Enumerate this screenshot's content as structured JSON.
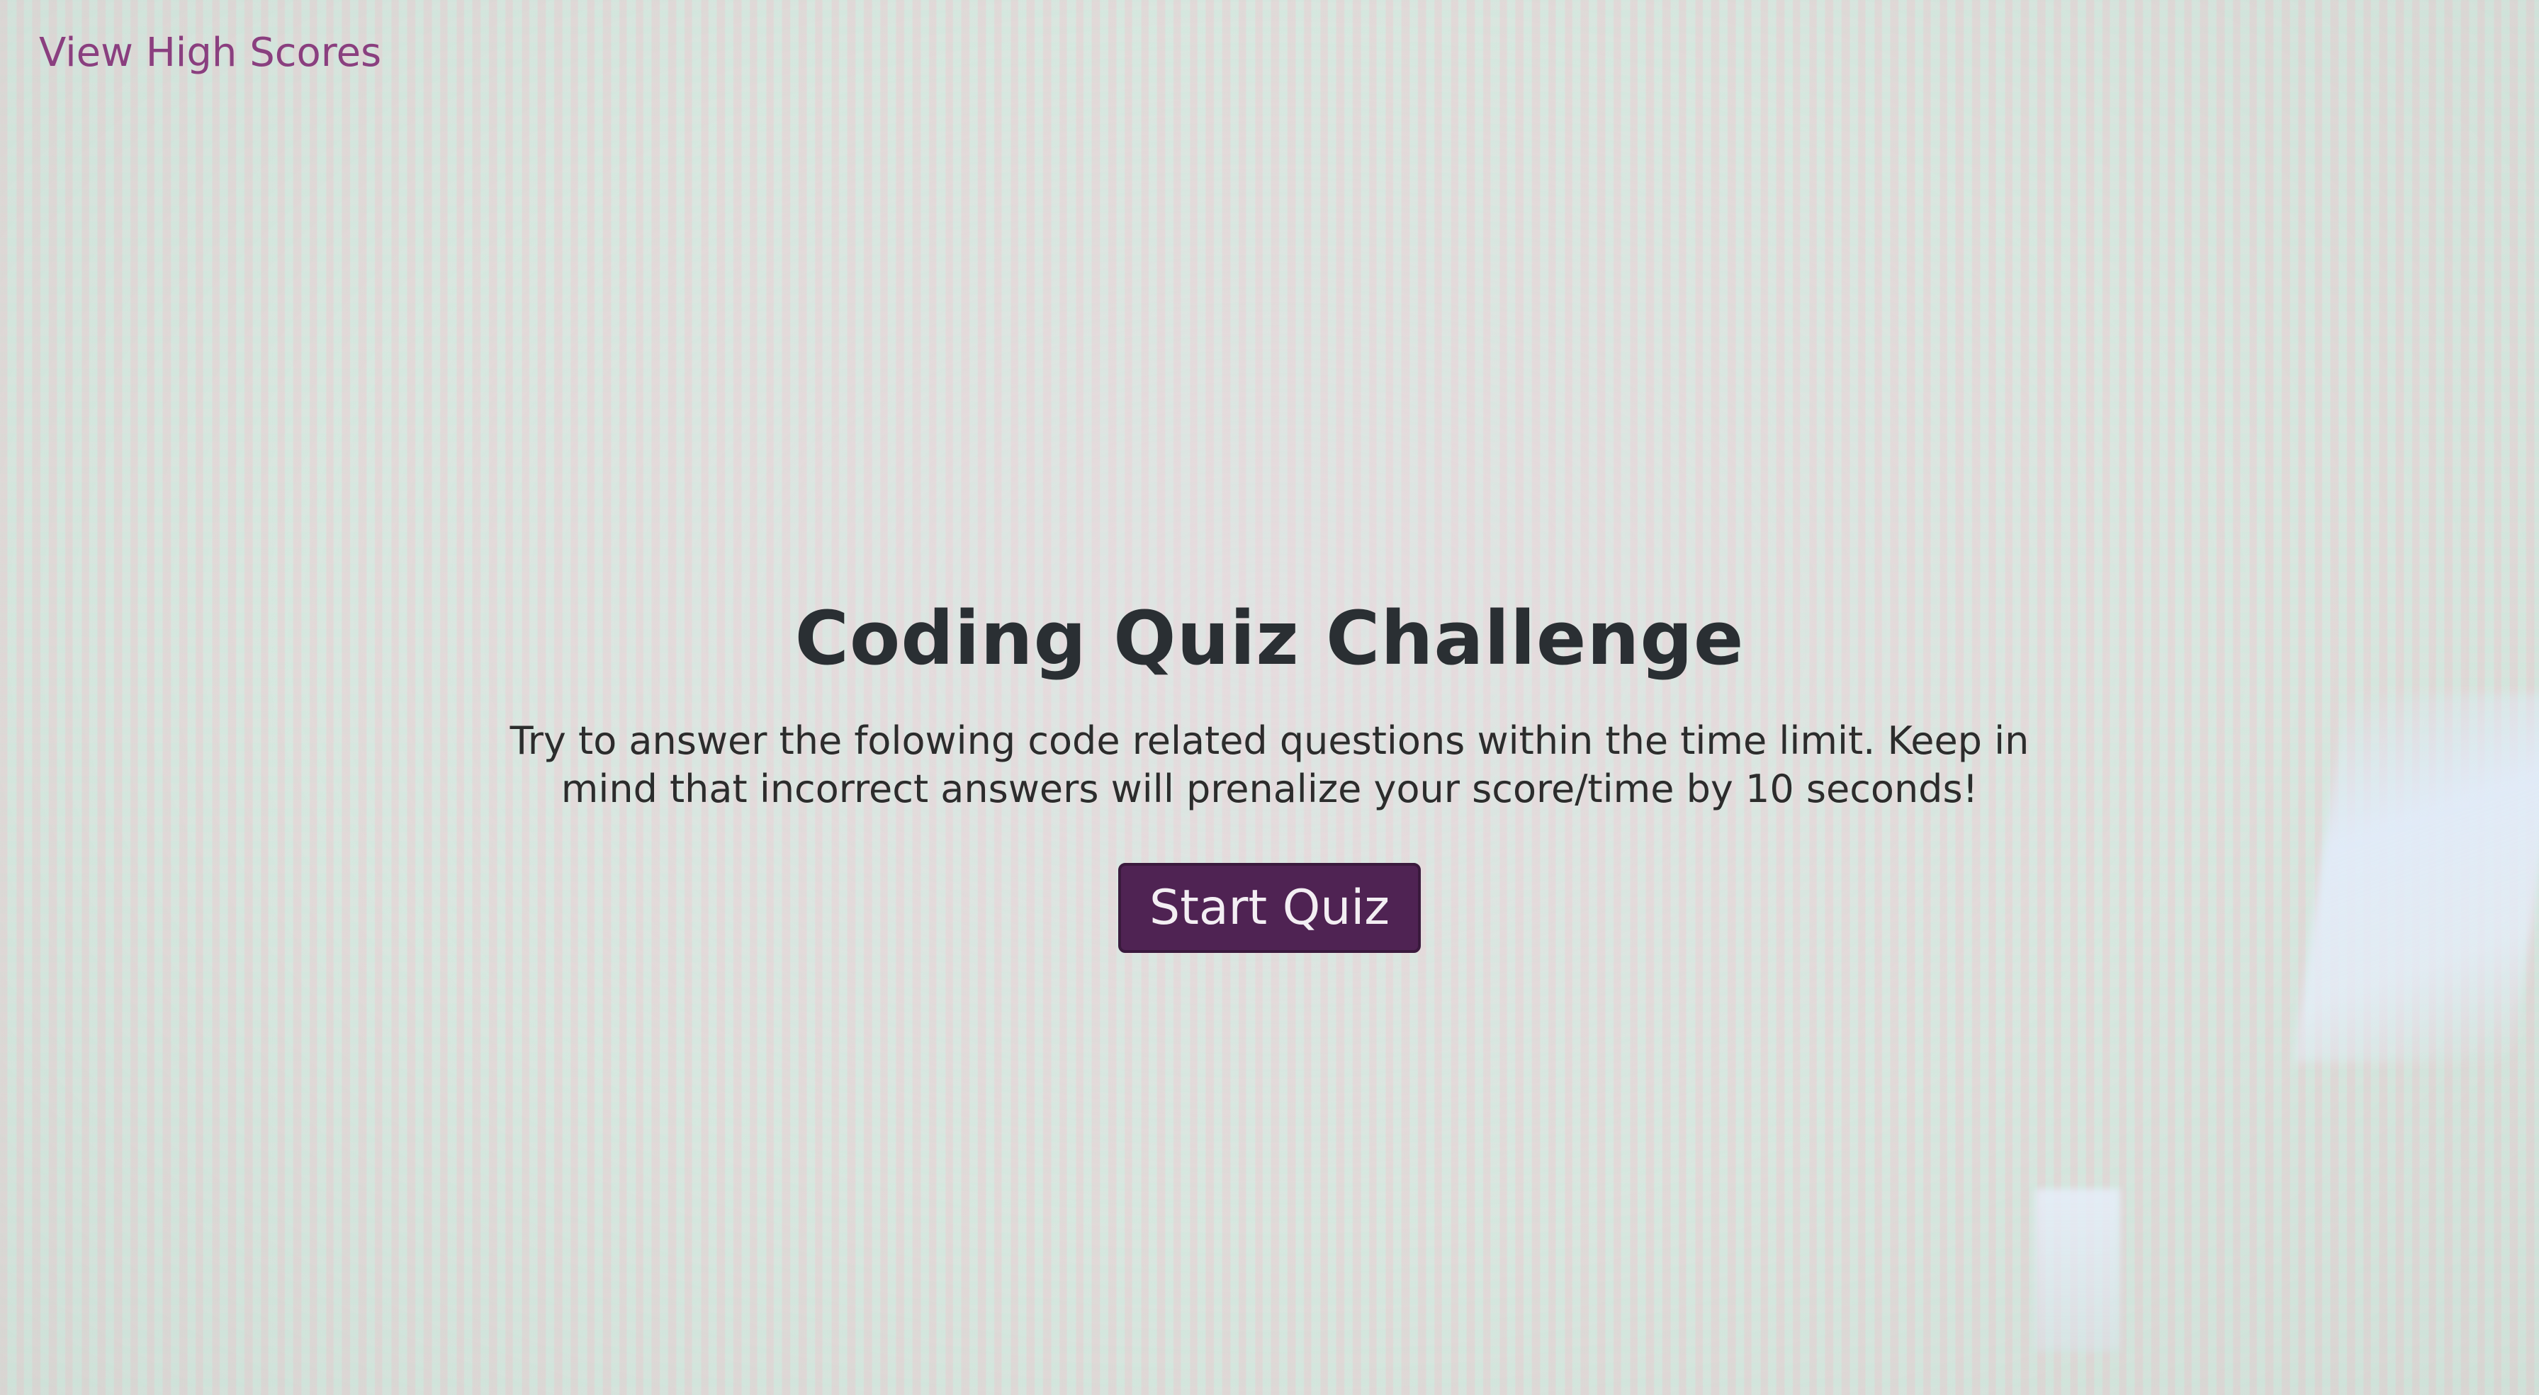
{
  "header": {
    "high_scores_link": "View High Scores"
  },
  "main": {
    "title": "Coding Quiz Challenge",
    "description": "Try to answer the folowing code related questions within the time limit. Keep in mind that incorrect answers will prenalize your score/time by 10 seconds!",
    "start_button_label": "Start Quiz"
  },
  "colors": {
    "link": "#8a3f7f",
    "button_background": "#4f2353",
    "title_text": "#2a2f33"
  }
}
